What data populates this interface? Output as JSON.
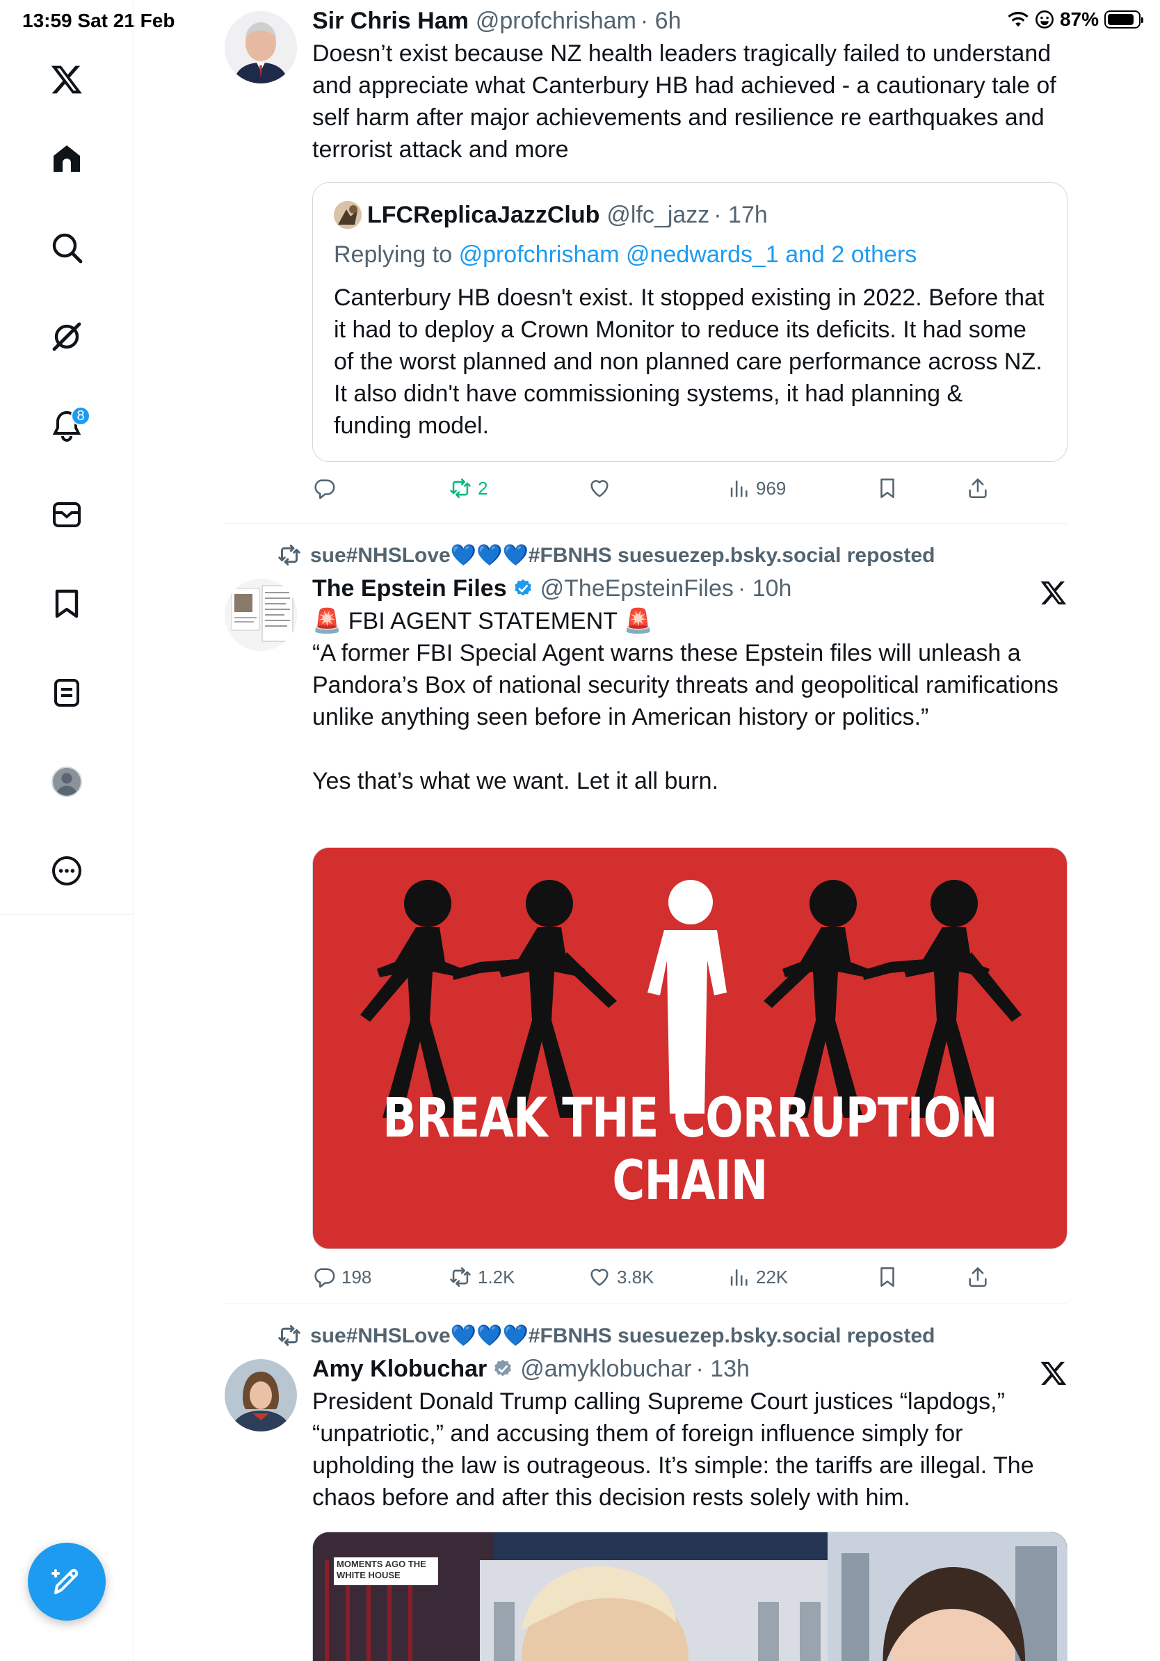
{
  "status": {
    "time_date": "13:59  Sat 21 Feb",
    "battery": "87%"
  },
  "sidebar": {
    "items": [
      {
        "name": "x-logo-icon"
      },
      {
        "name": "home-icon"
      },
      {
        "name": "search-icon"
      },
      {
        "name": "grok-icon"
      },
      {
        "name": "notifications-icon",
        "badge": "8"
      },
      {
        "name": "messages-icon"
      },
      {
        "name": "bookmarks-icon"
      },
      {
        "name": "lists-icon"
      },
      {
        "name": "profile-icon"
      },
      {
        "name": "more-icon"
      }
    ],
    "compose": "compose-post-icon"
  },
  "tweets": [
    {
      "name": "Sir Chris Ham",
      "handle": "@profchrisham",
      "time": "· 6h",
      "text": "Doesn’t exist because NZ health leaders tragically failed to understand and appreciate what Canterbury HB had achieved - a cautionary tale of self harm after major achievements and resilience re earthquakes and terrorist attack and more",
      "quote": {
        "name": "LFCReplicaJazzClub",
        "handle": "@lfc_jazz",
        "time": "· 17h",
        "replying_label": "Replying to",
        "replying_to": "@profchrisham @nedwards_1 and 2 others",
        "text": "Canterbury HB doesn't exist. It stopped existing in 2022. Before that it had to deploy a Crown Monitor to reduce its deficits. It had some of the worst planned and non planned care performance across NZ.  It also didn't have commissioning systems, it had planning & funding model."
      },
      "stats": {
        "replies": "",
        "reposts": "2",
        "likes": "",
        "views": "969"
      }
    },
    {
      "repost_by": "sue#NHSLove💙💙💙#FBNHS suesuezep.bsky.social reposted",
      "name": "The Epstein Files",
      "handle": "@TheEpsteinFiles",
      "time": "· 10h",
      "line1": "🚨 FBI AGENT STATEMENT 🚨",
      "text": "“A former FBI Special Agent warns these Epstein files will unleash a Pandora’s Box of national security threats and geopolitical ramifications unlike anything seen before in American history or politics.”",
      "text2": "Yes that’s what we want. Let it all burn.",
      "image_text": "BREAK THE CORRUPTION CHAIN",
      "stats": {
        "replies": "198",
        "reposts": "1.2K",
        "likes": "3.8K",
        "views": "22K"
      }
    },
    {
      "repost_by": "sue#NHSLove💙💙💙#FBNHS suesuezep.bsky.social reposted",
      "name": "Amy Klobuchar",
      "handle": "@amyklobuchar",
      "time": "· 13h",
      "text": "President Donald Trump calling Supreme Court justices “lapdogs,” “unpatriotic,” and accusing them of foreign influence simply for upholding the law is outrageous. It’s simple: the tariffs are illegal. The chaos before and after this decision rests solely with him.",
      "video_caption": "MOMENTS AGO THE WHITE HOUSE"
    }
  ],
  "colors": {
    "accent": "#1d9bf0",
    "repost_green": "#00ba7c",
    "banner_red": "#d32f2f"
  }
}
